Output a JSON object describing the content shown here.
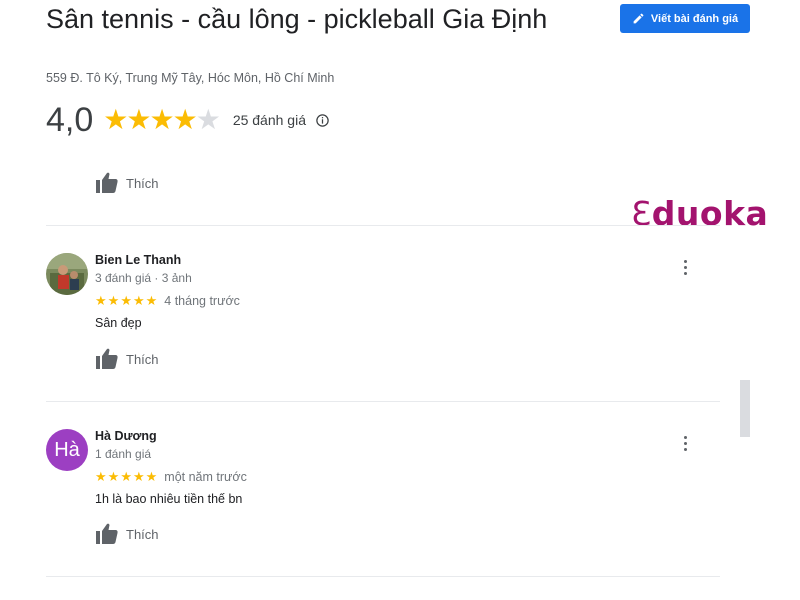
{
  "place": {
    "title": "Sân tennis - cầu lông - pickleball Gia Định",
    "address": "559 Đ. Tô Ký, Trung Mỹ Tây, Hóc Môn, Hồ Chí Minh"
  },
  "write_review_label": "Viết bài đánh giá",
  "summary": {
    "rating": "4,0",
    "stars_filled": 4,
    "stars_total": 5,
    "count_label": "25 đánh giá"
  },
  "like_label": "Thích",
  "brand": {
    "prefix": "Ɛ",
    "rest": "duoka",
    "color": "#a3136e"
  },
  "reviews": [
    {
      "name": "Bien Le Thanh",
      "meta": "3 đánh giá · 3 ảnh",
      "stars": 5,
      "time": "4 tháng trước",
      "text": "Sân đẹp",
      "avatar": "photo"
    },
    {
      "name": "Hà Dương",
      "meta": "1 đánh giá",
      "stars": 5,
      "time": "một năm trước",
      "text": "1h là bao nhiêu tiền thế bn",
      "avatar": "letter",
      "avatar_letter": "Hà",
      "avatar_color": "#9c3fc2"
    }
  ],
  "colors": {
    "accent": "#1a73e8",
    "star": "#fbbc04",
    "star_empty": "#dadce0"
  },
  "icons": {
    "write": "pencil-icon",
    "info": "info-icon",
    "like": "thumbs-up-icon",
    "more": "more-vert-icon"
  }
}
